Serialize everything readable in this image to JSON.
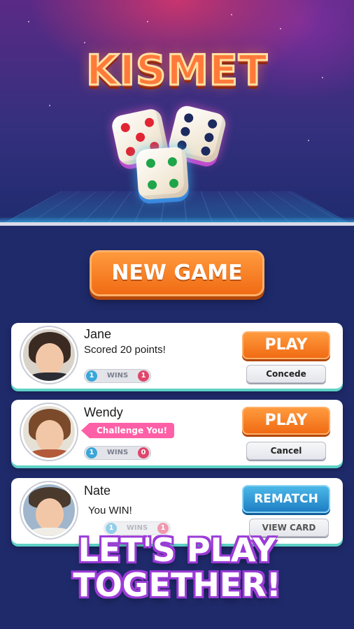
{
  "hero": {
    "logo_text": "KISMET"
  },
  "new_game_label": "NEW GAME",
  "matches": [
    {
      "name": "Jane",
      "status": "Scored 20 points!",
      "wins_label": "WINS",
      "wins_left": "1",
      "wins_right": "1",
      "primary_action": "PLAY",
      "secondary_action": "Concede"
    },
    {
      "name": "Wendy",
      "status": "Challenge You!",
      "wins_label": "WINS",
      "wins_left": "1",
      "wins_right": "0",
      "primary_action": "PLAY",
      "secondary_action": "Cancel"
    },
    {
      "name": "Nate",
      "status": "You WIN!",
      "wins_label": "WINS",
      "wins_left": "1",
      "wins_right": "1",
      "primary_action": "REMATCH",
      "secondary_action": "VIEW CARD"
    }
  ],
  "tagline": {
    "line1": "LET'S PLAY",
    "line2": "TOGETHER!"
  },
  "colors": {
    "primary_orange": "#f06b14",
    "rematch_blue": "#1e7fc4",
    "tagline_purple": "#9b3bd6",
    "background_navy": "#1f2a6b"
  }
}
